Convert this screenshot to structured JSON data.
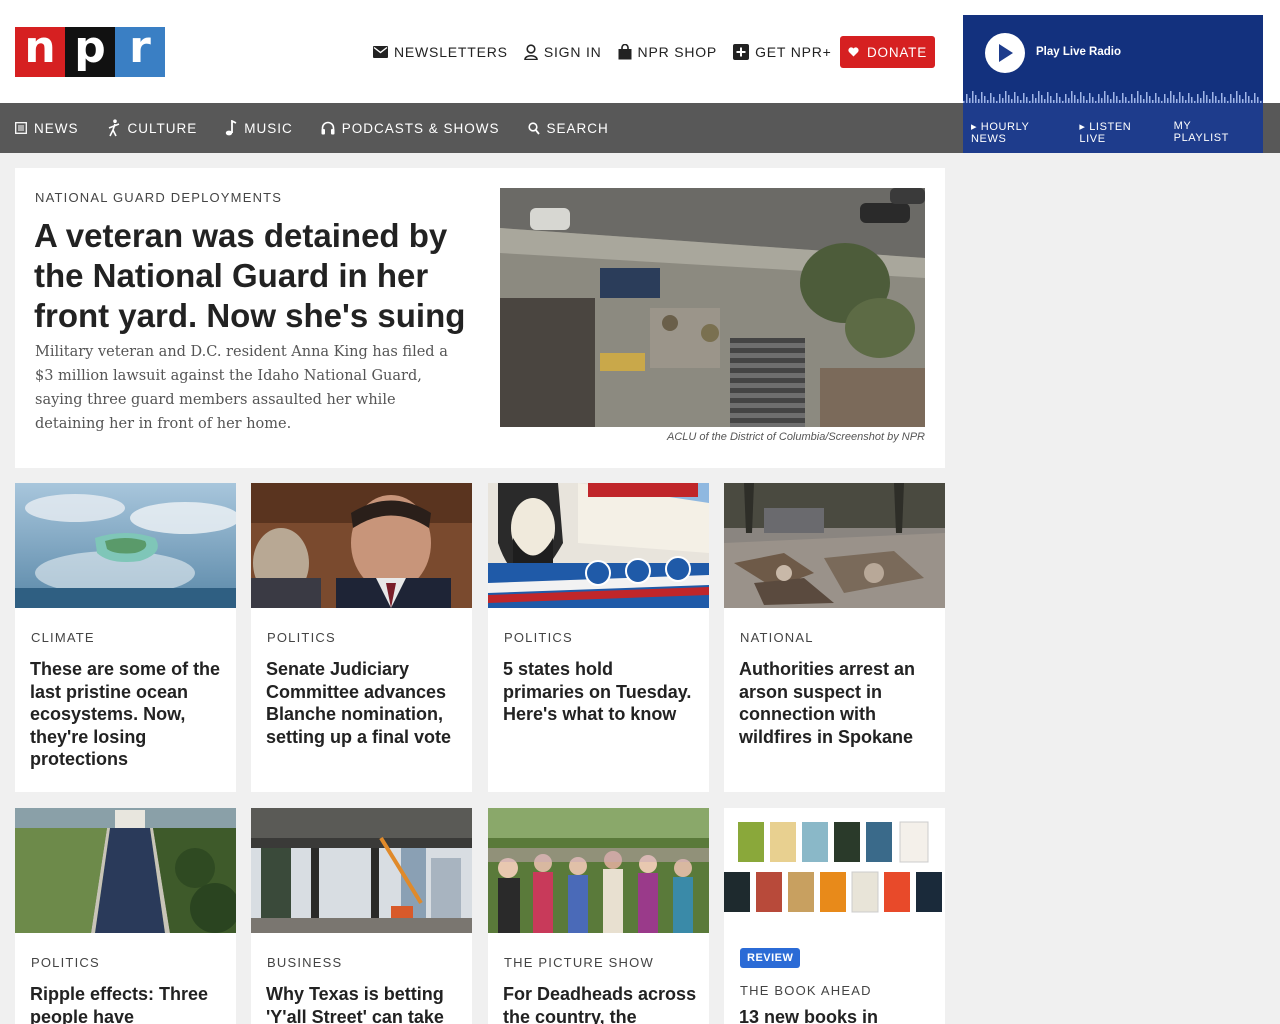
{
  "brand": {
    "letters": [
      "n",
      "p",
      "r"
    ],
    "colors": [
      "#d62021",
      "#111111",
      "#3a7fc4"
    ]
  },
  "utility_nav": [
    {
      "label": "NEWSLETTERS",
      "icon": "mail-icon"
    },
    {
      "label": "SIGN IN",
      "icon": "user-icon"
    },
    {
      "label": "NPR SHOP",
      "icon": "shopping-bag-icon"
    },
    {
      "label": "GET NPR+",
      "icon": "plus-box-icon"
    }
  ],
  "donate": {
    "label": "DONATE",
    "icon": "heart-icon",
    "color": "#d62021"
  },
  "main_nav": [
    {
      "label": "NEWS",
      "icon": "newspaper-icon"
    },
    {
      "label": "CULTURE",
      "icon": "dancer-icon"
    },
    {
      "label": "MUSIC",
      "icon": "music-note-icon"
    },
    {
      "label": "PODCASTS & SHOWS",
      "icon": "headphones-icon"
    },
    {
      "label": "SEARCH",
      "icon": "search-icon"
    }
  ],
  "player": {
    "play_label": "Play Live Radio",
    "links": [
      "HOURLY NEWS",
      "LISTEN LIVE",
      "MY PLAYLIST"
    ]
  },
  "hero": {
    "slug": "NATIONAL GUARD DEPLOYMENTS",
    "title": "A veteran was detained by the National Guard in her front yard. Now she's suing",
    "teaser": "Military veteran and D.C. resident Anna King has filed a $3 million lawsuit against the Idaho National Guard, saying three guard members assaulted her while detaining her in front of her home.",
    "credit": "ACLU of the District of Columbia/Screenshot by NPR"
  },
  "stories_row1": [
    {
      "slug": "CLIMATE",
      "title": "These are some of the last pristine ocean ecosystems. Now, they're losing protections"
    },
    {
      "slug": "POLITICS",
      "title": "Senate Judiciary Committee advances Blanche nomination, setting up a final vote"
    },
    {
      "slug": "POLITICS",
      "title": "5 states hold primaries on Tuesday. Here's what to know"
    },
    {
      "slug": "NATIONAL",
      "title": "Authorities arrest an arson suspect in connection with wildfires in Spokane"
    }
  ],
  "stories_row2": [
    {
      "slug": "POLITICS",
      "title": "Ripple effects: Three people have"
    },
    {
      "slug": "BUSINESS",
      "title": "Why Texas is betting 'Y'all Street' can take"
    },
    {
      "slug": "THE PICTURE SHOW",
      "title": "For Deadheads across the country, the"
    },
    {
      "badge": "REVIEW",
      "slug": "THE BOOK AHEAD",
      "title": "13 new books in"
    }
  ]
}
